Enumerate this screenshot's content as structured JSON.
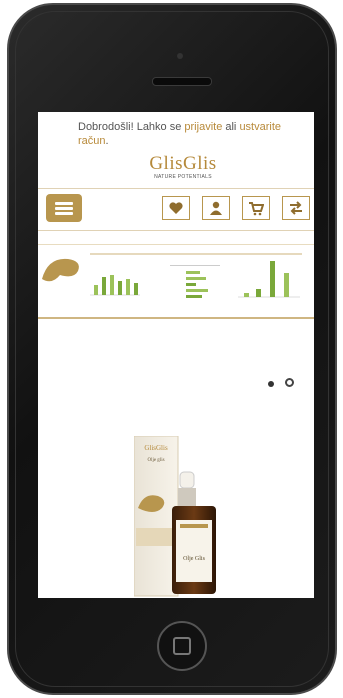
{
  "welcome": {
    "text_before": "Dobrodošli! Lahko se ",
    "login_link": "prijavite",
    "text_mid": " ali ",
    "register_link": "ustvarite račun",
    "text_after": "."
  },
  "logo": {
    "name": "GlisGlis",
    "tagline": "NATURE POTENTIALS"
  },
  "header_icons": [
    "heart-icon",
    "user-icon",
    "cart-icon",
    "compare-icon"
  ],
  "product": {
    "box_brand": "GlisGlis",
    "box_label": "Olje glis",
    "bottle_label": "Olje Glis"
  },
  "accent_color": "#b8964e"
}
